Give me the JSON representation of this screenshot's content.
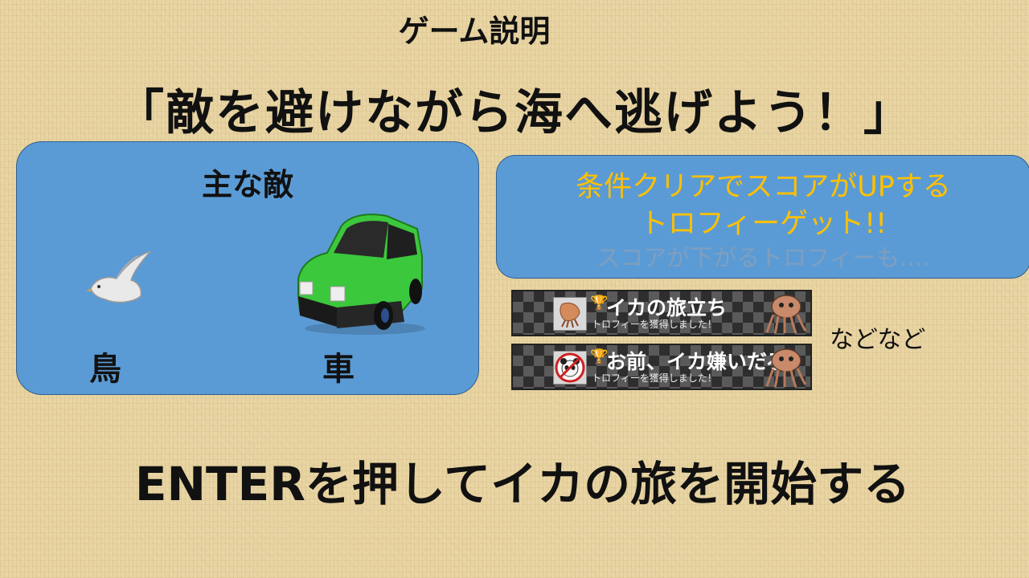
{
  "header": {
    "subtitle": "ゲーム説明",
    "headline": "「敵を避けながら海へ逃げよう！」"
  },
  "enemies": {
    "title": "主な敵",
    "items": [
      {
        "label": "鳥",
        "icon": "bird-icon"
      },
      {
        "label": "車",
        "icon": "car-icon"
      }
    ]
  },
  "trophies": {
    "line1": "条件クリアでスコアがUPする",
    "line2": "トロフィーゲット!!",
    "line3": "スコアが下がるトロフィーも….",
    "banners": [
      {
        "title": "イカの旅立ち",
        "subtitle": "トロフィーを獲得しました！",
        "icon": "squid-icon"
      },
      {
        "title": "お前、イカ嫌いだろ",
        "subtitle": "トロフィーを獲得しました！",
        "icon": "panda-icon"
      }
    ],
    "etc": "などなど"
  },
  "footer": {
    "start": "ENTERを押してイカの旅を開始する"
  },
  "colors": {
    "panel": "#5b9bd5",
    "trophy_text": "#ffc000",
    "car": "#3cc83c"
  }
}
